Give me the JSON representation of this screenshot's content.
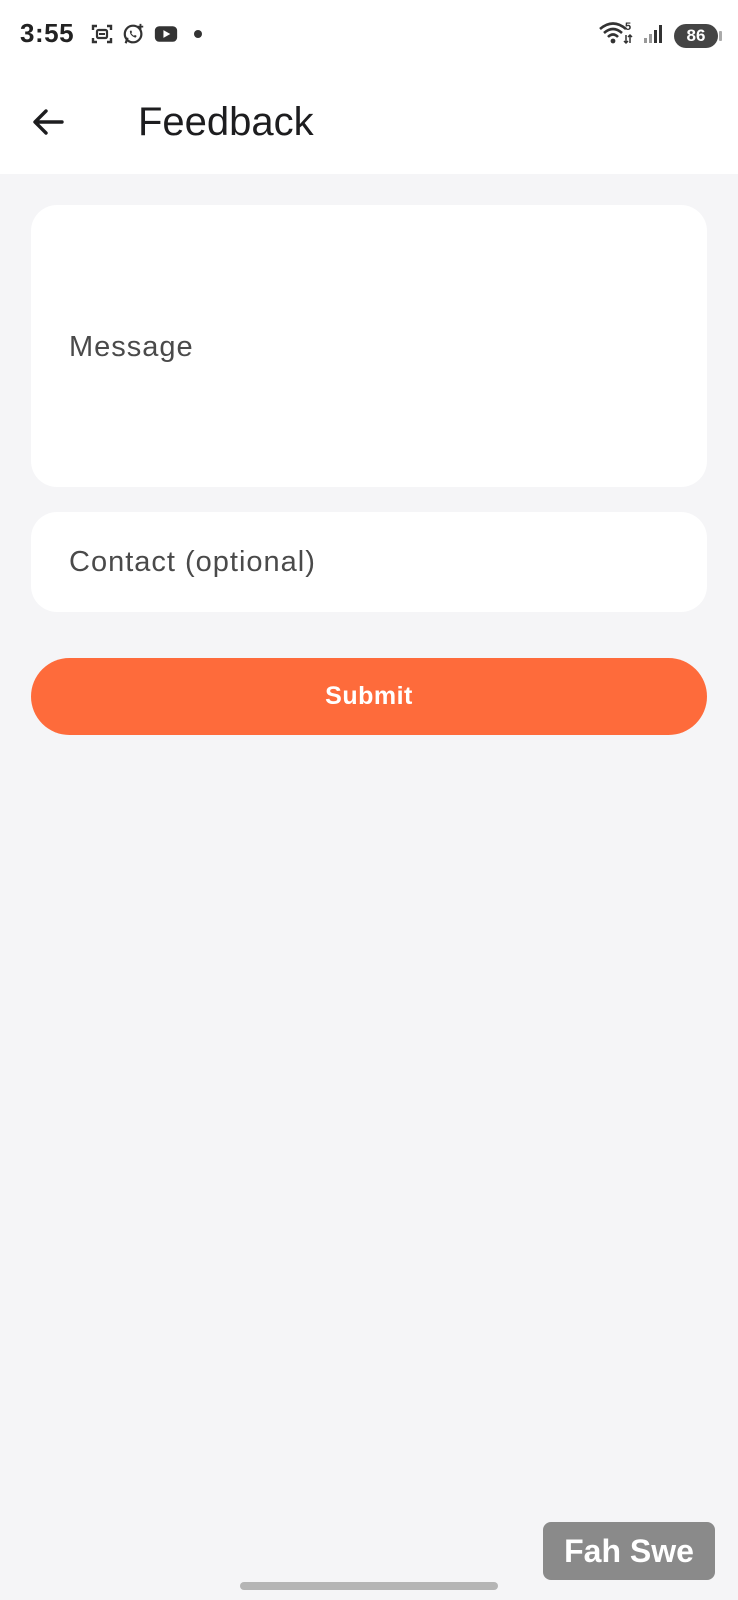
{
  "status_bar": {
    "time": "3:55",
    "battery": "86",
    "wifi_label": "5",
    "icons_left": [
      "scan-icon",
      "whatsapp-icon",
      "youtube-icon",
      "notification-dot-icon"
    ],
    "icons_right": [
      "wifi-icon",
      "cellular-signal-icon",
      "battery-icon"
    ]
  },
  "app_bar": {
    "title": "Feedback",
    "back_icon": "arrow-left-icon"
  },
  "form": {
    "message_placeholder": "Message",
    "message_value": "",
    "contact_placeholder": "Contact (optional)",
    "contact_value": "",
    "submit_label": "Submit"
  },
  "watermark": {
    "text": "Fah Swe"
  },
  "colors": {
    "accent": "#fe6b3b",
    "background": "#f5f5f7",
    "surface": "#ffffff"
  }
}
